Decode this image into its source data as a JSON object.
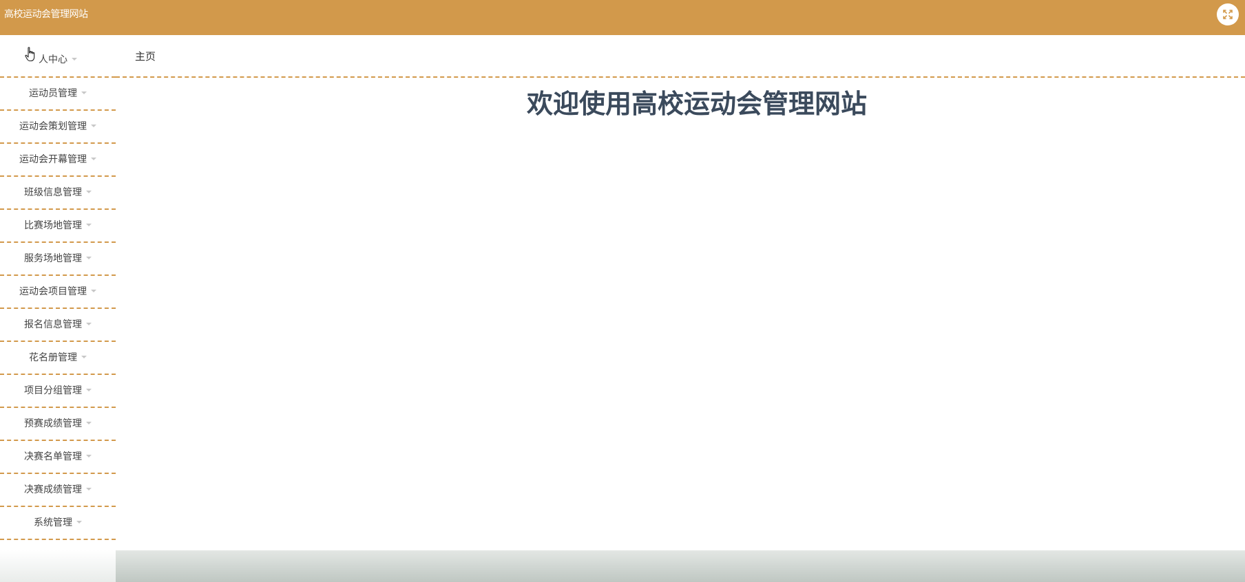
{
  "app": {
    "title": "高校运动会管理网站"
  },
  "colors": {
    "topbar": "#d2994b",
    "divider": "#d2994b",
    "welcome_text": "#3b4a5c"
  },
  "header": {
    "breadcrumb_home": "主页"
  },
  "main": {
    "welcome": "欢迎使用高校运动会管理网站"
  },
  "sidebar": {
    "items": [
      {
        "label": "人中心"
      },
      {
        "label": "运动员管理"
      },
      {
        "label": "运动会策划管理"
      },
      {
        "label": "运动会开幕管理"
      },
      {
        "label": "班级信息管理"
      },
      {
        "label": "比赛场地管理"
      },
      {
        "label": "服务场地管理"
      },
      {
        "label": "运动会项目管理"
      },
      {
        "label": "报名信息管理"
      },
      {
        "label": "花名册管理"
      },
      {
        "label": "项目分组管理"
      },
      {
        "label": "预赛成绩管理"
      },
      {
        "label": "决赛名单管理"
      },
      {
        "label": "决赛成绩管理"
      },
      {
        "label": "系统管理"
      }
    ]
  },
  "icons": {
    "fullscreen": "fullscreen-toggle-icon",
    "cursor": "hand-pointer-cursor-icon",
    "caret": "caret-down-icon"
  }
}
